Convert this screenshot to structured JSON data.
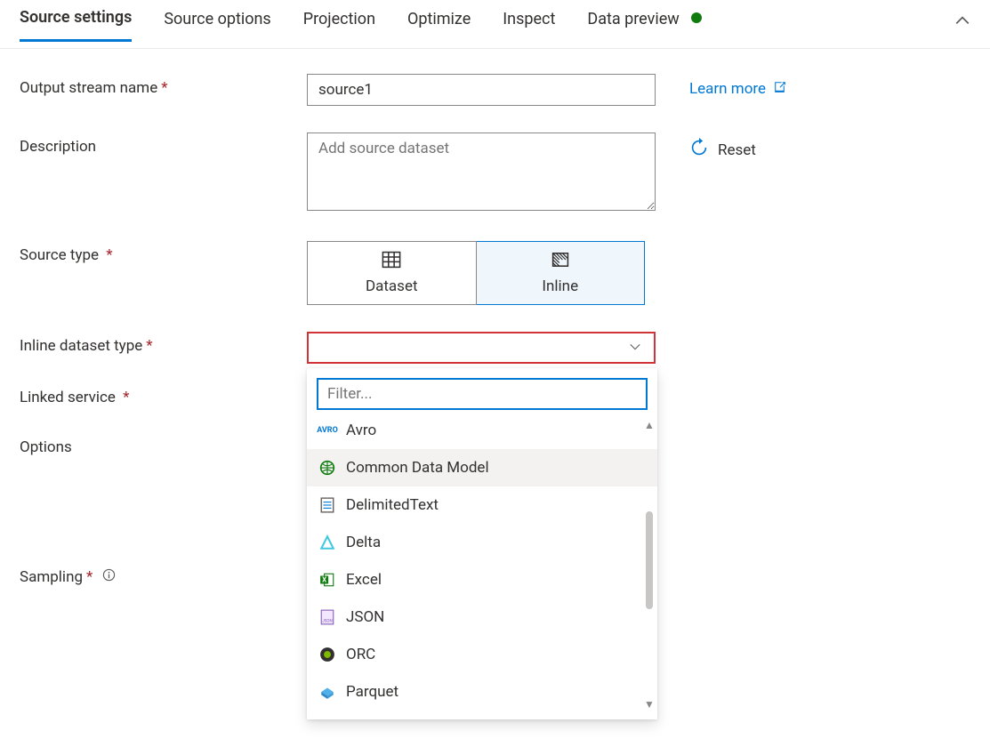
{
  "tabs": {
    "source_settings": "Source settings",
    "source_options": "Source options",
    "projection": "Projection",
    "optimize": "Optimize",
    "inspect": "Inspect",
    "data_preview": "Data preview"
  },
  "labels": {
    "output_stream_name": "Output stream name",
    "description": "Description",
    "source_type": "Source type",
    "inline_dataset_type": "Inline dataset type",
    "linked_service": "Linked service",
    "options": "Options",
    "sampling": "Sampling"
  },
  "fields": {
    "output_stream_name_value": "source1",
    "description_placeholder": "Add source dataset",
    "filter_placeholder": "Filter..."
  },
  "source_type": {
    "dataset": "Dataset",
    "inline": "Inline"
  },
  "side": {
    "learn_more": "Learn more",
    "reset": "Reset"
  },
  "dataset_types": {
    "avro": "Avro",
    "cdm": "Common Data Model",
    "delimited": "DelimitedText",
    "delta": "Delta",
    "excel": "Excel",
    "json": "JSON",
    "orc": "ORC",
    "parquet": "Parquet"
  },
  "tooltip": "Common Data Model"
}
